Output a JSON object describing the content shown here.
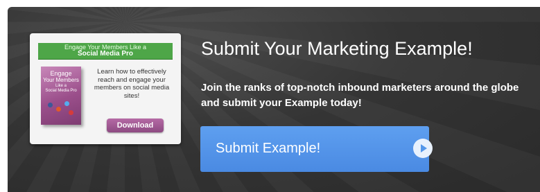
{
  "card": {
    "header_line1": "Engage Your Members Like a",
    "header_line2": "Social Media Pro",
    "book_line1": "Engage",
    "book_line2": "Your Members",
    "book_line3": "Like a",
    "book_line4": "Social Media Pro",
    "description": "Learn how to effectively reach and engage your members on social media sites!",
    "download_label": "Download"
  },
  "main": {
    "title": "Submit Your Marketing Example!",
    "subtitle": "Join the ranks of top-notch inbound marketers around the globe and submit your Example today!",
    "submit_label": "Submit Example!"
  },
  "colors": {
    "banner": "#333333",
    "card_header": "#4ea648",
    "download_button": "#9b4f8b",
    "submit_button": "#5497ea"
  },
  "icons": {
    "submit_arrow": "arrow-right-circle-icon"
  }
}
